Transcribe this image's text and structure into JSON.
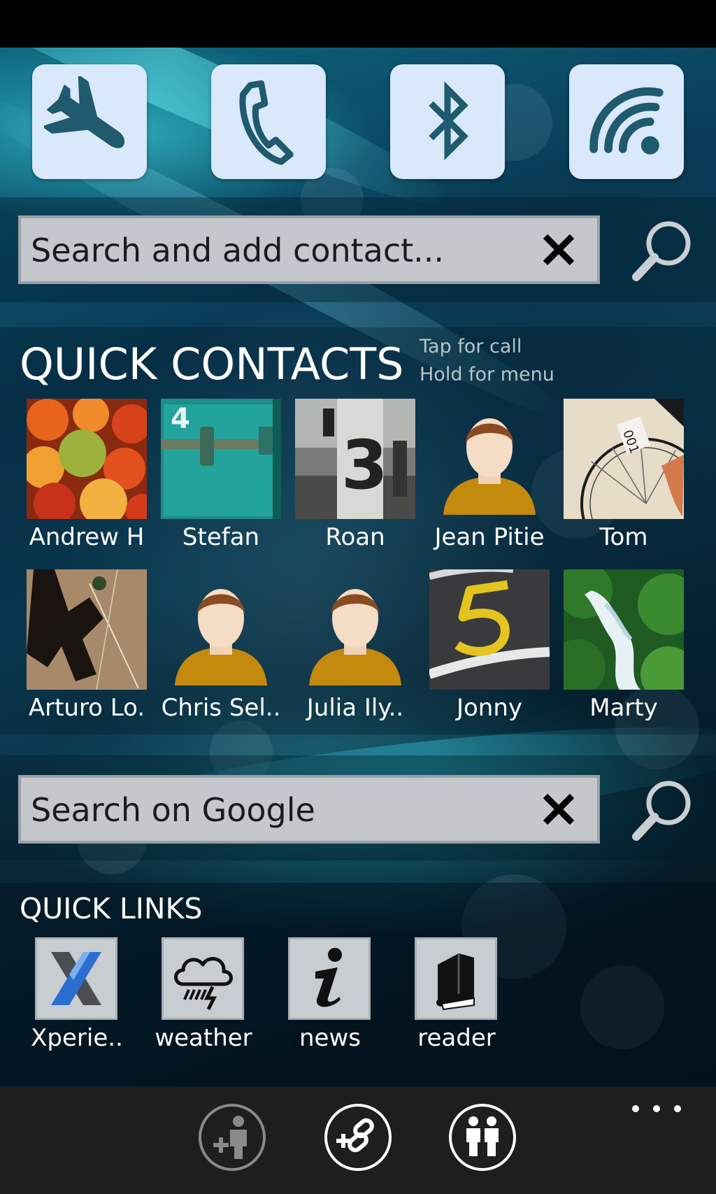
{
  "quick_toggles": [
    {
      "name": "airplane-mode",
      "icon": "airplane-icon"
    },
    {
      "name": "phone",
      "icon": "phone-icon"
    },
    {
      "name": "bluetooth",
      "icon": "bluetooth-icon"
    },
    {
      "name": "wifi",
      "icon": "wifi-icon"
    }
  ],
  "contact_search": {
    "placeholder": "Search and add contact..."
  },
  "quick_contacts": {
    "title": "QUICK CONTACTS",
    "hint_tap": "Tap for call",
    "hint_hold": "Hold for menu",
    "contacts": [
      {
        "name": "Andrew H",
        "photo": "fruit"
      },
      {
        "name": "Stefan",
        "photo": "green-door"
      },
      {
        "name": "Roan",
        "photo": "pillar-3"
      },
      {
        "name": "Jean Pitie",
        "photo": "default-avatar"
      },
      {
        "name": "Tom",
        "photo": "bicycle"
      },
      {
        "name": "Arturo Lo.",
        "photo": "shadow"
      },
      {
        "name": "Chris Sel..",
        "photo": "default-avatar"
      },
      {
        "name": "Julia Ily..",
        "photo": "default-avatar"
      },
      {
        "name": "Jonny",
        "photo": "asphalt-5"
      },
      {
        "name": "Marty",
        "photo": "waterfall"
      }
    ]
  },
  "google_search": {
    "placeholder": "Search on Google"
  },
  "quick_links": {
    "title": "QUICK LINKS",
    "links": [
      {
        "label": "Xperie..",
        "icon": "xperia-icon"
      },
      {
        "label": "weather",
        "icon": "weather-icon"
      },
      {
        "label": "news",
        "icon": "news-icon"
      },
      {
        "label": "reader",
        "icon": "reader-icon"
      }
    ]
  },
  "app_bar": {
    "buttons": [
      {
        "icon": "add-contact-icon"
      },
      {
        "icon": "add-link-icon"
      },
      {
        "icon": "contacts-icon"
      }
    ],
    "more": "more-icon"
  },
  "colors": {
    "toggle_tile": "#d9e8fb",
    "toggle_icon": "#1f5a6e",
    "search_field": "#c4c8cc",
    "app_bar": "#1e1e1e",
    "avatar_shirt": "#c48a0e"
  }
}
